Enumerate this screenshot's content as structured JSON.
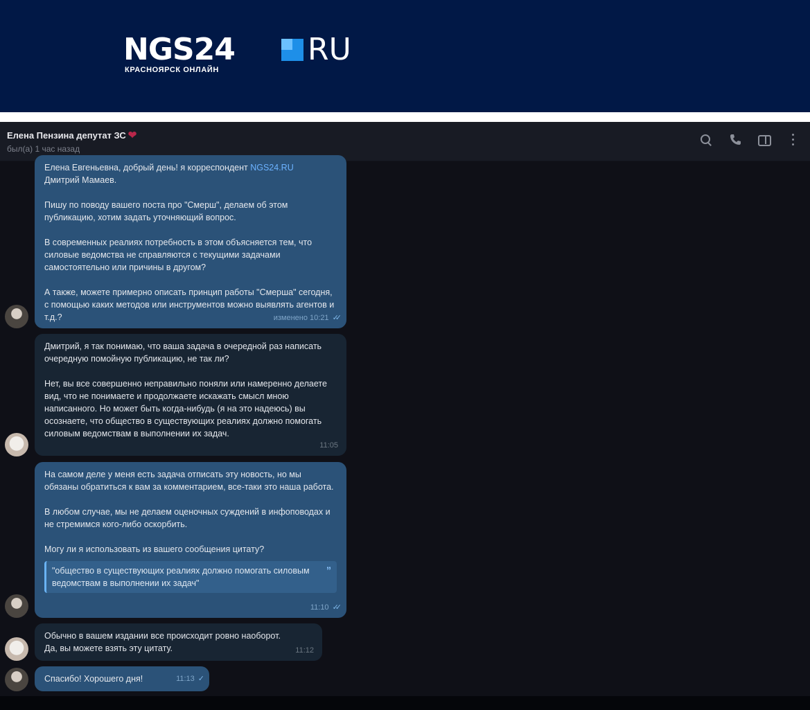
{
  "banner": {
    "logo_main": "NGS24",
    "logo_ru": "RU",
    "logo_sub": "КРАСНОЯРСК ОНЛАЙН"
  },
  "header": {
    "name": "Елена Пензина депутат ЗС",
    "heart": "❤",
    "status": "был(а) 1 час назад",
    "icons": [
      "search-icon",
      "phone-icon",
      "panel-icon",
      "more-icon"
    ]
  },
  "messages": [
    {
      "direction": "out",
      "intro_a": "Елена Евгеньевна, добрый день! я корреспондент ",
      "intro_link": "NGS24.RU",
      "intro_b": "Дмитрий Мамаев.",
      "paragraphs": [
        "Пишу по поводу вашего поста про \"Смерш\", делаем об этом публикацию, хотим задать уточняющий вопрос.",
        "В современных реалиях потребность в этом объясняется тем, что силовые ведомства не справляются с текущими задачами самостоятельно или причины в другом?",
        "А также, можете примерно описать принцип работы \"Смерша\" сегодня, с помощью каких методов или инструментов можно выявлять агентов и т.д.?"
      ],
      "time": "изменено 10:21"
    },
    {
      "direction": "in",
      "paragraphs": [
        "Дмитрий, я так понимаю, что ваша задача в очередной раз написать очередную помойную публикацию, не так ли?",
        "Нет, вы все совершенно неправильно поняли или намеренно делаете вид, что не понимаете и продолжаете искажать смысл мною написанного. Но может быть когда-нибудь (я на это надеюсь) вы осознаете, что общество в существующих реалиях должно помогать силовым ведомствам в выполнении их задач."
      ],
      "time": "11:05"
    },
    {
      "direction": "out",
      "paragraphs": [
        "На самом деле у меня есть задача отписать эту новость, но мы обязаны обратиться к вам за комментарием, все-таки это наша работа.",
        "В любом случае, мы не делаем оценочных суждений в инфоповодах и не стремимся кого-либо оскорбить.",
        "Могу ли я использовать из вашего сообщения цитату?"
      ],
      "quote": "\"общество в существующих реалиях должно помогать силовым ведомствам в выполнении их задач\"",
      "time": "11:10"
    },
    {
      "direction": "in",
      "paragraphs": [
        "Обычно в вашем издании все происходит ровно наоборот. Да, вы можете взять эту цитату."
      ],
      "time": "11:12"
    },
    {
      "direction": "out",
      "paragraphs": [
        "Спасибо! Хорошего дня!"
      ],
      "time": "11:13"
    }
  ]
}
